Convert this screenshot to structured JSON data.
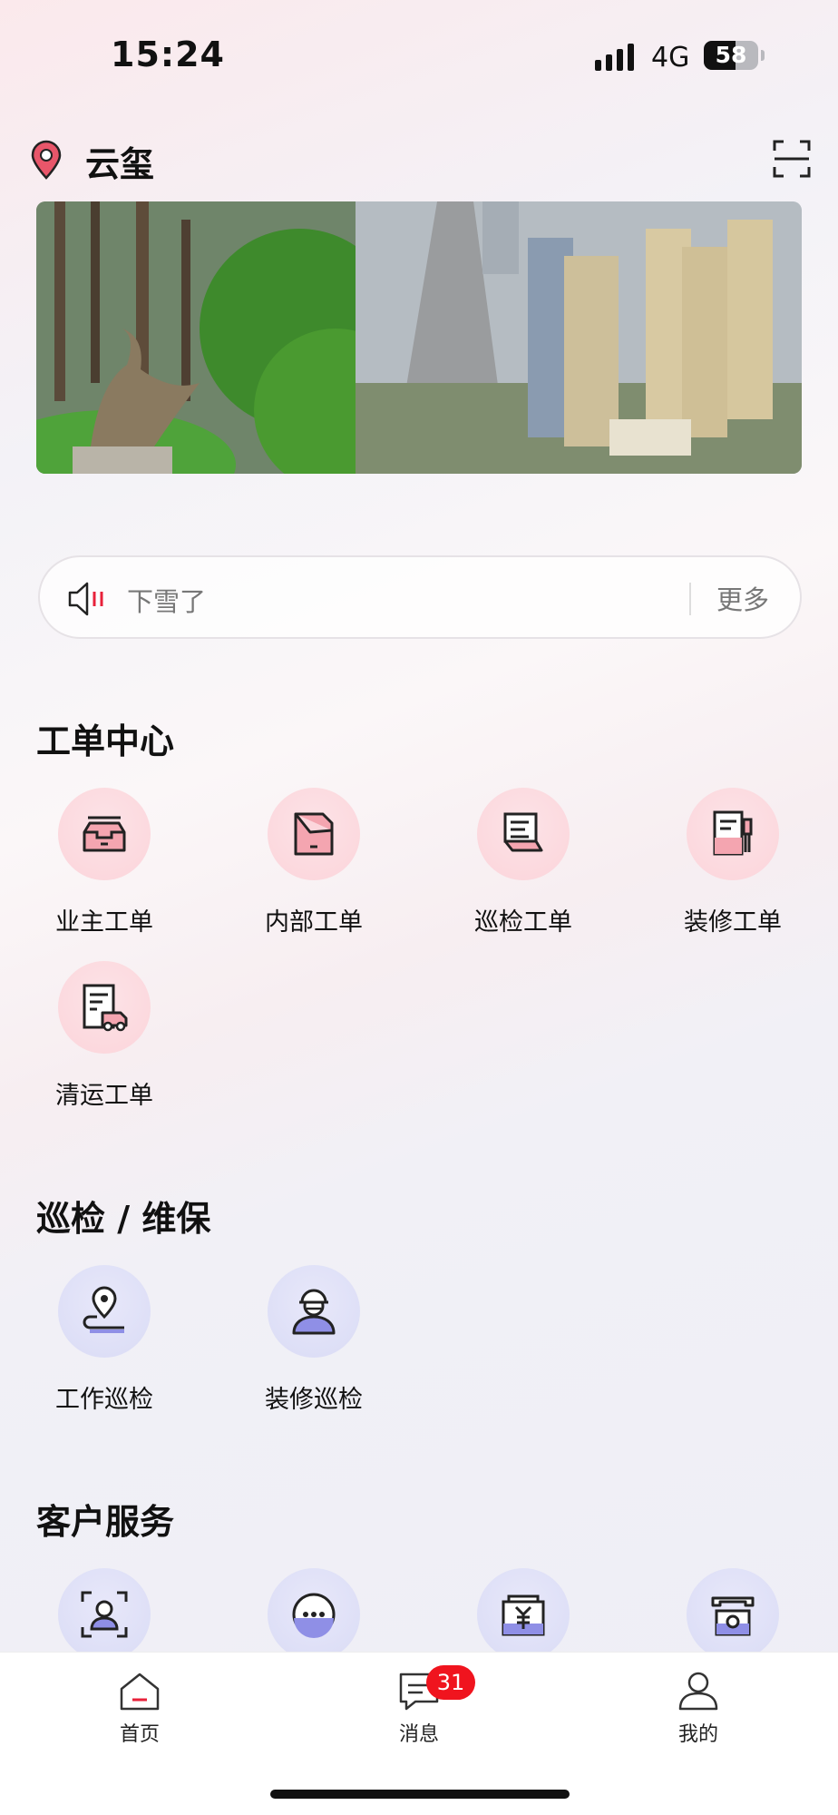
{
  "status_bar": {
    "time": "15:24",
    "network": "4G",
    "battery_level": "58",
    "battery_fraction": 0.58
  },
  "header": {
    "community_name": "云玺"
  },
  "notice": {
    "text": "下雪了",
    "more_label": "更多"
  },
  "work_order_center": {
    "title": "工单中心",
    "items": [
      {
        "label": "业主工单",
        "icon": "inbox-tray-icon"
      },
      {
        "label": "内部工单",
        "icon": "folded-document-icon"
      },
      {
        "label": "巡检工单",
        "icon": "checklist-document-icon"
      },
      {
        "label": "装修工单",
        "icon": "document-brush-icon"
      },
      {
        "label": "清运工单",
        "icon": "document-truck-icon"
      }
    ]
  },
  "inspection": {
    "title": "巡检 / 维保",
    "items": [
      {
        "label": "工作巡检",
        "icon": "location-pin-route-icon"
      },
      {
        "label": "装修巡检",
        "icon": "worker-helmet-icon"
      }
    ]
  },
  "customer_service": {
    "title": "客户服务",
    "items": [
      {
        "icon": "face-scan-icon"
      },
      {
        "icon": "chat-bubble-icon"
      },
      {
        "icon": "yuan-payment-icon"
      },
      {
        "icon": "telephone-icon"
      }
    ]
  },
  "tab_bar": {
    "tabs": [
      {
        "label": "首页",
        "icon": "home-icon"
      },
      {
        "label": "消息",
        "icon": "message-icon",
        "badge": "31"
      },
      {
        "label": "我的",
        "icon": "profile-icon"
      }
    ]
  },
  "colors": {
    "accent": "#f0141e",
    "pink_circle": "#fbd4da",
    "blue_circle": "#d9dbf5"
  }
}
